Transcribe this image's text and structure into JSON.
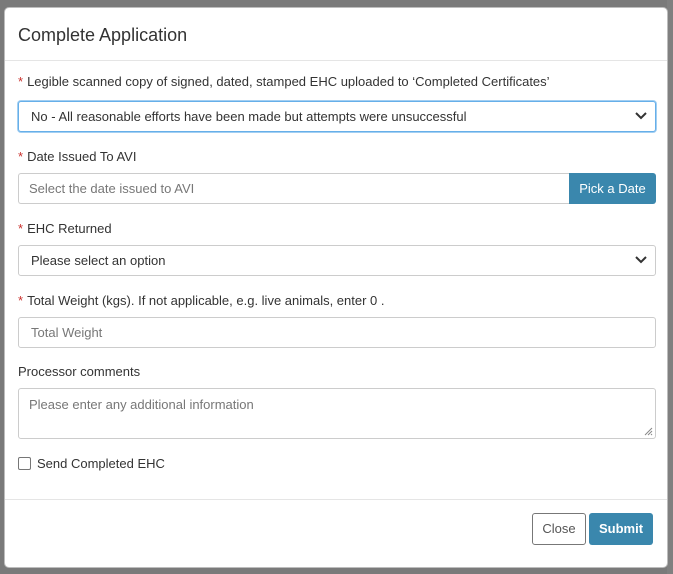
{
  "modal": {
    "title": "Complete Application"
  },
  "form": {
    "required_marker": "*",
    "certificate": {
      "label": "Legible scanned copy of signed, dated, stamped EHC uploaded to ‘Completed Certificates’",
      "selected": "No - All reasonable efforts have been made but attempts were unsuccessful"
    },
    "date_issued": {
      "label": "Date Issued To AVI",
      "placeholder": "Select the date issued to AVI",
      "button_label": "Pick a Date"
    },
    "ehc_returned": {
      "label": "EHC Returned",
      "selected": "Please select an option"
    },
    "total_weight": {
      "label": "Total Weight (kgs). If not applicable, e.g. live animals, enter 0 .",
      "placeholder": "Total Weight"
    },
    "comments": {
      "label": "Processor comments",
      "placeholder": "Please enter any additional information"
    },
    "send_completed": {
      "label": "Send Completed EHC",
      "checked": false
    }
  },
  "footer": {
    "close_label": "Close",
    "submit_label": "Submit"
  },
  "colors": {
    "primary": "#3a87ad",
    "required": "#c9302c",
    "focus": "#66afe9"
  }
}
